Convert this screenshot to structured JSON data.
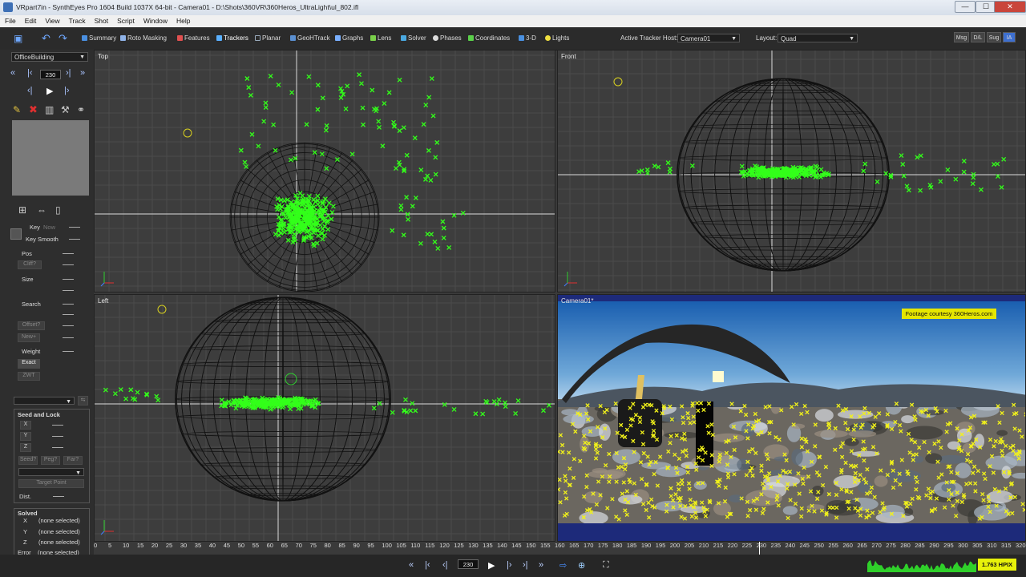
{
  "window": {
    "title": "VRpart7in - SynthEyes Pro 1604 Build 1037X 64-bit - Camera01 - D:\\Shots\\360VR\\360Heros_UltraLight\\ul_802.ifl",
    "minimize": "—",
    "maximize": "☐",
    "close": "✕"
  },
  "menu": [
    "File",
    "Edit",
    "View",
    "Track",
    "Shot",
    "Script",
    "Window",
    "Help"
  ],
  "toolbar": {
    "tabs": [
      "Summary",
      "Roto Masking",
      "Features",
      "Trackers",
      "Planar",
      "GeoHTrack",
      "Graphs",
      "Lens",
      "Solver",
      "Phases",
      "Coordinates",
      "3-D",
      "Lights"
    ],
    "active_tab": "Trackers",
    "tracker_host_label": "Active Tracker Host:",
    "tracker_host_value": "Camera01",
    "layout_label": "Layout:",
    "layout_value": "Quad",
    "right_buttons": [
      "Msg",
      "D/L",
      "Sug",
      "IA"
    ]
  },
  "left_panel": {
    "object_select": "OfficeBuilding",
    "frame": "230",
    "labels": {
      "key": "Key",
      "now": "Now",
      "key_smooth": "Key Smooth",
      "pos": "Pos",
      "cliff": "Cliff?",
      "size": "Size",
      "search": "Search",
      "offset": "Offset?",
      "new": "New+",
      "weight": "Weight",
      "exact": "Exact",
      "zwt": "ZWT"
    },
    "seed_lock": {
      "title": "Seed and Lock",
      "x": "X",
      "y": "Y",
      "z": "Z",
      "seed": "Seed?",
      "peg": "Peg?",
      "far": "Far?",
      "target_point": "Target Point",
      "dist": "Dist."
    },
    "solved": {
      "title": "Solved",
      "rows": [
        {
          "axis": "X",
          "value": "(none selected)"
        },
        {
          "axis": "Y",
          "value": "(none selected)"
        },
        {
          "axis": "Z",
          "value": "(none selected)"
        }
      ],
      "error_label": "Error",
      "error_value": "(none selected)"
    }
  },
  "viewports": {
    "top": "Top",
    "front": "Front",
    "left": "Left",
    "camera": "Camera01*"
  },
  "camera_caption": "Footage courtesy 360Heros.com",
  "timeline": {
    "start": 0,
    "end": 320,
    "step": 5,
    "current": 230
  },
  "transport": {
    "frame": "230",
    "hpix": "1.763 HPIX"
  },
  "colors": {
    "tracker_green": "#33ff1a",
    "tracker_yellow": "#f2f21a",
    "viewport_bg": "#3d3d3d",
    "sphere": "#111111"
  }
}
